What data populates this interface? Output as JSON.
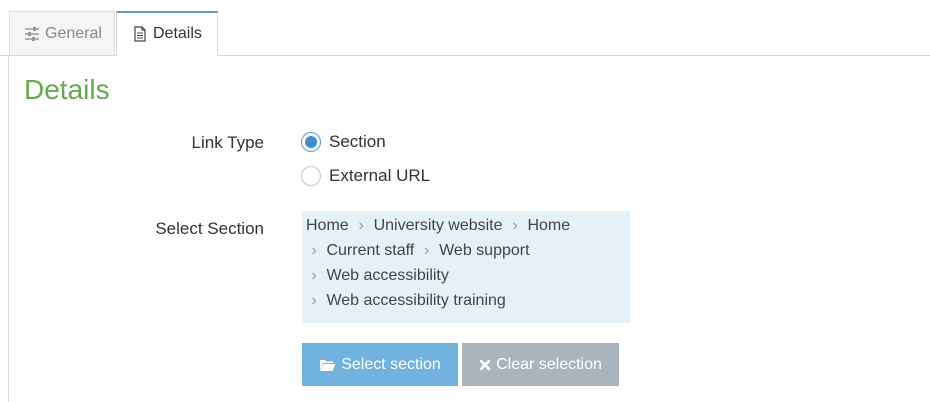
{
  "tabs": [
    {
      "label": "General",
      "icon": "sliders-icon",
      "active": false
    },
    {
      "label": "Details",
      "icon": "document-icon",
      "active": true
    }
  ],
  "heading": "Details",
  "link_type": {
    "label": "Link Type",
    "options": [
      {
        "label": "Section",
        "checked": true
      },
      {
        "label": "External URL",
        "checked": false
      }
    ]
  },
  "select_section": {
    "label": "Select Section",
    "breadcrumb": {
      "root": "Home",
      "items": [
        "University website",
        "Home",
        "Current staff",
        "Web support",
        "Web accessibility",
        "Web accessibility training"
      ]
    }
  },
  "buttons": {
    "select_label": "Select section",
    "clear_label": "Clear selection"
  },
  "colors": {
    "heading": "#6aa84f",
    "select_button": "#72b2e0",
    "clear_button": "#a9b4bc",
    "breadcrumb_bg": "#e6f0f7",
    "radio_accent": "#3b8fd0"
  }
}
